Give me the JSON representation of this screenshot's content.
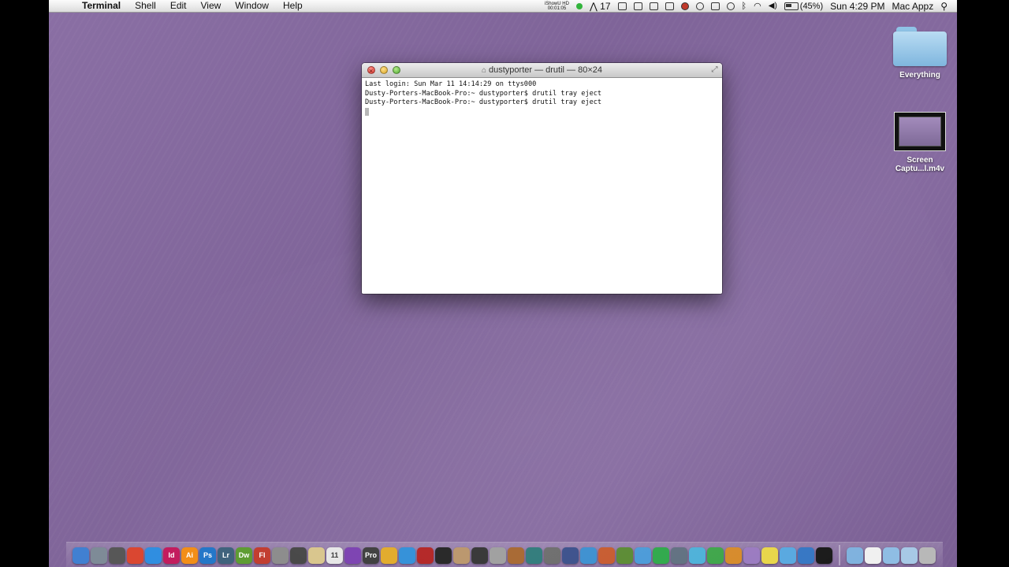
{
  "menubar": {
    "app_name": "Terminal",
    "menus": [
      "Shell",
      "Edit",
      "View",
      "Window",
      "Help"
    ],
    "ishowu": "iShowU HD",
    "ishowu_time": "00:01:05",
    "adobe_count": "17",
    "battery": "(45%)",
    "clock": "Sun 4:29 PM",
    "user": "Mac Appz"
  },
  "desktop": {
    "folder_label": "Everything",
    "movie_label_line1": "Screen",
    "movie_label_line2": "Captu...l.m4v"
  },
  "terminal": {
    "title": "dustyporter — drutil — 80×24",
    "lines": [
      "Last login: Sun Mar 11 14:14:29 on ttys000",
      "Dusty-Porters-MacBook-Pro:~ dustyporter$ drutil tray eject",
      "Dusty-Porters-MacBook-Pro:~ dustyporter$ drutil tray eject"
    ]
  },
  "dock": {
    "apps": [
      {
        "name": "finder",
        "label": "",
        "color": "#3f7fd1"
      },
      {
        "name": "safari",
        "label": "",
        "color": "#7d8a96"
      },
      {
        "name": "photo-app",
        "label": "",
        "color": "#555555"
      },
      {
        "name": "chrome",
        "label": "",
        "color": "#d9442e"
      },
      {
        "name": "safari-compass",
        "label": "",
        "color": "#2c8ce0"
      },
      {
        "name": "indesign",
        "label": "Id",
        "color": "#c2185b"
      },
      {
        "name": "illustrator",
        "label": "Ai",
        "color": "#f28c13"
      },
      {
        "name": "photoshop",
        "label": "Ps",
        "color": "#1f74c7"
      },
      {
        "name": "lightroom",
        "label": "Lr",
        "color": "#3b5f7a"
      },
      {
        "name": "dreamweaver",
        "label": "Dw",
        "color": "#5a9a2e"
      },
      {
        "name": "flash",
        "label": "Fl",
        "color": "#c0392b"
      },
      {
        "name": "automator",
        "label": "",
        "color": "#8a8a8a"
      },
      {
        "name": "app-hat",
        "label": "",
        "color": "#444444"
      },
      {
        "name": "notes",
        "label": "",
        "color": "#d8c48a"
      },
      {
        "name": "ical",
        "label": "11",
        "color": "#e6e6e6"
      },
      {
        "name": "purple-app",
        "label": "",
        "color": "#7a3fb0"
      },
      {
        "name": "final-cut-pro",
        "label": "Pro",
        "color": "#3b3b3b"
      },
      {
        "name": "headphones",
        "label": "",
        "color": "#e1a928"
      },
      {
        "name": "itunes",
        "label": "",
        "color": "#2f8ed8"
      },
      {
        "name": "book-app",
        "label": "",
        "color": "#b22222"
      },
      {
        "name": "dvd-player",
        "label": "",
        "color": "#222222"
      },
      {
        "name": "preview",
        "label": "",
        "color": "#b9946a"
      },
      {
        "name": "clapper",
        "label": "",
        "color": "#333333"
      },
      {
        "name": "xcode-tools",
        "label": "",
        "color": "#9e9e9e"
      },
      {
        "name": "guitar",
        "label": "",
        "color": "#a6662f"
      },
      {
        "name": "time-machine",
        "label": "",
        "color": "#2e7a7a"
      },
      {
        "name": "utility",
        "label": "",
        "color": "#6c6c6c"
      },
      {
        "name": "quill",
        "label": "",
        "color": "#3a4f8a"
      },
      {
        "name": "chart-app",
        "label": "",
        "color": "#3b8fd0"
      },
      {
        "name": "presentation",
        "label": "",
        "color": "#c65a2e"
      },
      {
        "name": "cube",
        "label": "",
        "color": "#5a8a32"
      },
      {
        "name": "disk-app",
        "label": "",
        "color": "#4a9ad8"
      },
      {
        "name": "colorful-app",
        "label": "",
        "color": "#2ea84a"
      },
      {
        "name": "network-app",
        "label": "",
        "color": "#607080"
      },
      {
        "name": "bird-app",
        "label": "",
        "color": "#4db0d8"
      },
      {
        "name": "leaf-app",
        "label": "",
        "color": "#3ea54a"
      },
      {
        "name": "fish-app",
        "label": "",
        "color": "#d68a2a"
      },
      {
        "name": "crystal",
        "label": "",
        "color": "#9a7ac0"
      },
      {
        "name": "stickies",
        "label": "",
        "color": "#e8d64a"
      },
      {
        "name": "messages",
        "label": "",
        "color": "#58a8e0"
      },
      {
        "name": "magnifier",
        "label": "",
        "color": "#3677c4"
      },
      {
        "name": "terminal",
        "label": "",
        "color": "#1a1a1a"
      }
    ],
    "stacks": [
      {
        "name": "applications-folder",
        "color": "#7fb2de"
      },
      {
        "name": "documents-stack",
        "color": "#f0f0f0"
      },
      {
        "name": "downloads-folder",
        "color": "#8fbde4"
      },
      {
        "name": "desktop-folder",
        "color": "#a7c9e6"
      },
      {
        "name": "trash",
        "color": "#b8b8b8"
      }
    ]
  }
}
